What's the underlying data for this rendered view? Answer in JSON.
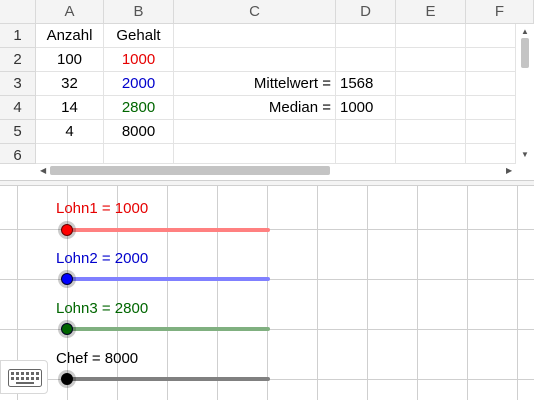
{
  "spreadsheet": {
    "columns": [
      "A",
      "B",
      "C",
      "D",
      "E",
      "F"
    ],
    "rows": [
      "1",
      "2",
      "3",
      "4",
      "5",
      "6"
    ],
    "cells": {
      "A1": "Anzahl",
      "B1": "Gehalt",
      "A2": "100",
      "B2": "1000",
      "A3": "32",
      "B3": "2000",
      "C3": "Mittelwert =",
      "D3": "1568",
      "A4": "14",
      "B4": "2800",
      "C4": "Median =",
      "D4": "1000",
      "A5": "4",
      "B5": "8000"
    },
    "colors": {
      "B2": "#e60000",
      "B3": "#0000cc",
      "B4": "#006600",
      "B5": "#000000"
    }
  },
  "sliders": [
    {
      "label": "Lohn1 = 1000",
      "value": 1000,
      "color": "#ff0000"
    },
    {
      "label": "Lohn2 = 2000",
      "value": 2000,
      "color": "#0000ff"
    },
    {
      "label": "Lohn3 = 2800",
      "value": 2800,
      "color": "#006400"
    },
    {
      "label": "Chef = 8000",
      "value": 8000,
      "color": "#000000"
    }
  ],
  "toolbar": {
    "keyboard_icon": "keyboard-icon"
  }
}
